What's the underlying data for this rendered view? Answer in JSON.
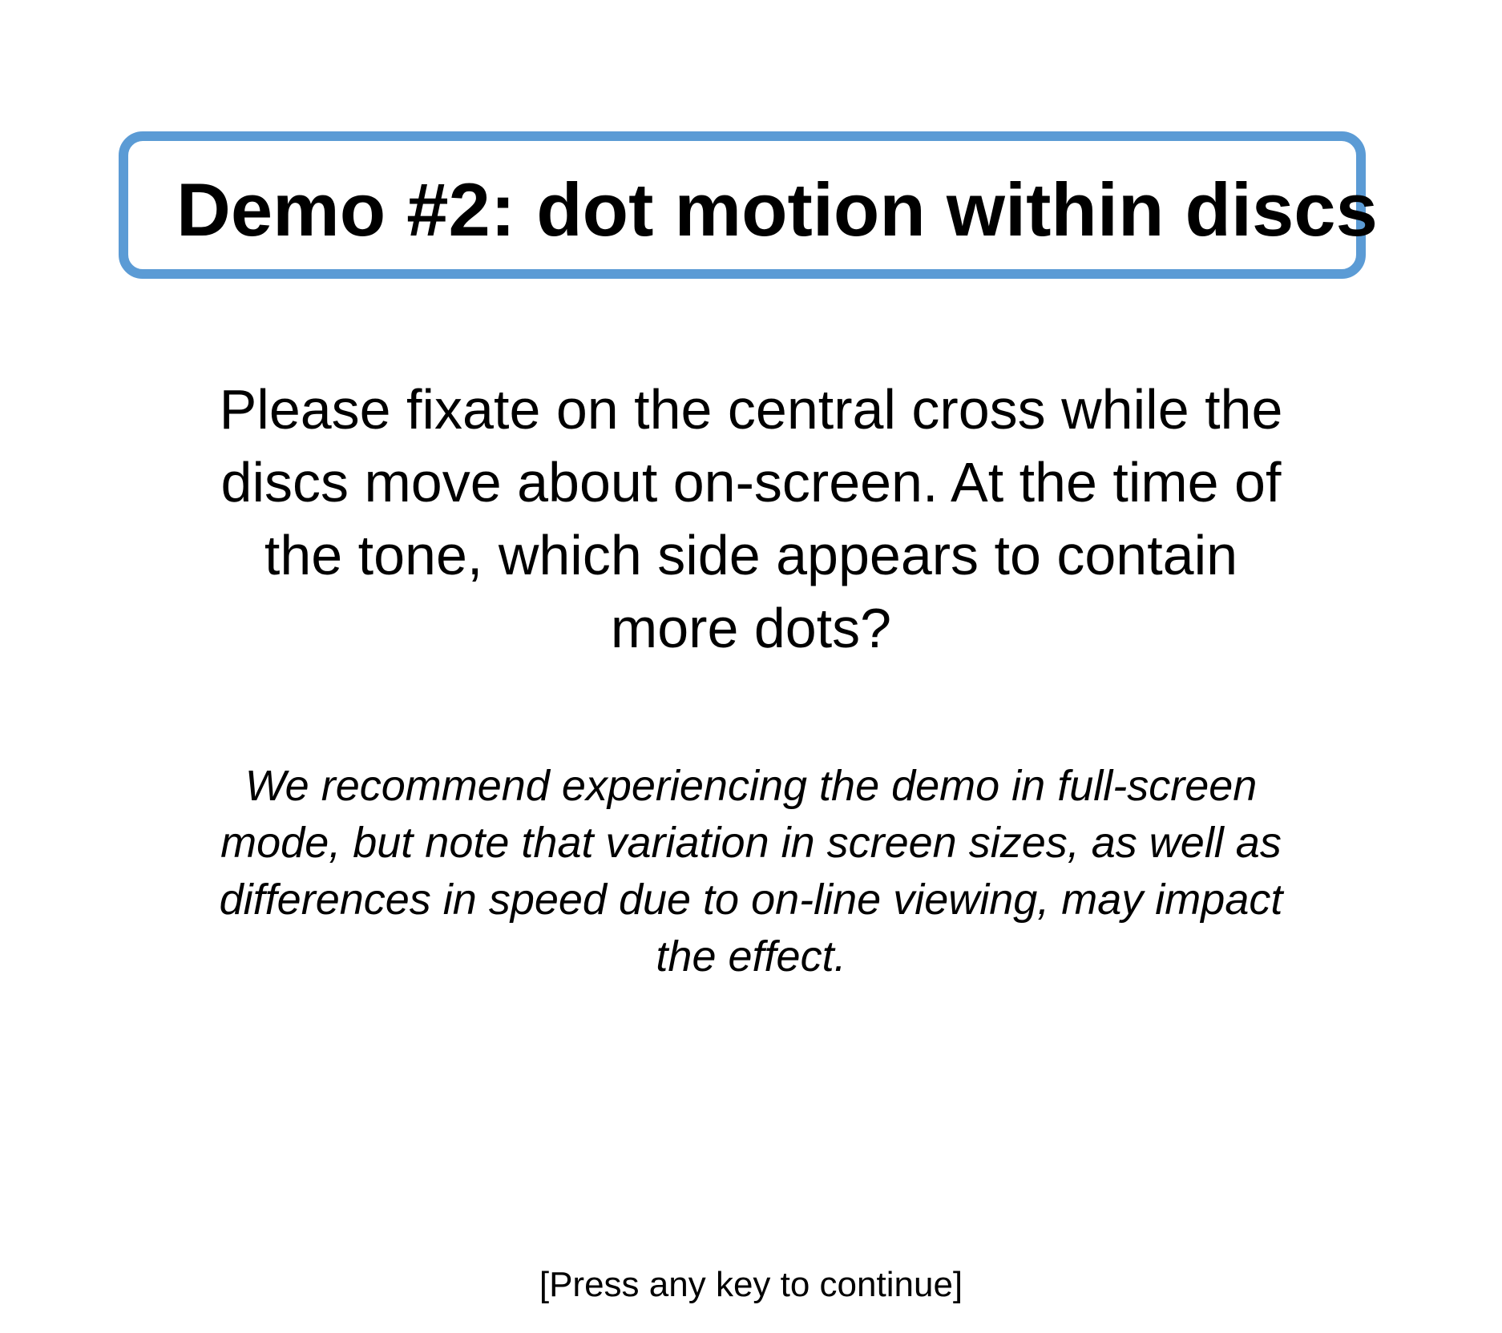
{
  "title": "Demo #2: dot motion within discs",
  "instructions": {
    "lines": [
      "Please fixate on the central cross while the",
      "discs move about on-screen. At the time of",
      "the tone, which side appears to contain",
      "more dots?"
    ]
  },
  "recommendation": {
    "lines": [
      "We recommend experiencing the demo in full-screen",
      "mode, but note that variation in screen sizes, as well as",
      "differences in speed due to on-line viewing, may impact",
      "the effect."
    ]
  },
  "continue_prompt": "[Press any key to continue]",
  "colors": {
    "title_border": "#5b9bd5",
    "background": "#ffffff",
    "text": "#000000"
  }
}
